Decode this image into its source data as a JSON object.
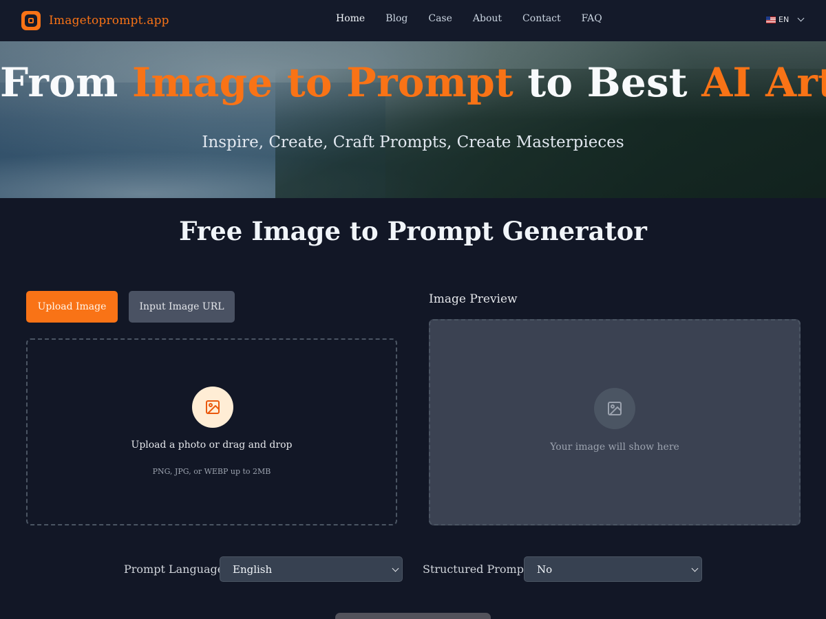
{
  "nav": {
    "brand": "Imagetoprompt.app",
    "links": [
      "Home",
      "Blog",
      "Case",
      "About",
      "Contact",
      "FAQ"
    ],
    "language": "EN"
  },
  "hero": {
    "title_part1": "From ",
    "title_accent1": "Image to Prompt",
    "title_part2": " to Best ",
    "title_accent2": "AI Art",
    "subtitle": "Inspire, Create, Craft Prompts, Create Masterpieces"
  },
  "main": {
    "title": "Free Image to Prompt Generator",
    "tabs": [
      "Upload Image",
      "Input Image URL"
    ],
    "upload": {
      "text": "Upload a photo or drag and drop",
      "hint": "PNG, JPG, or WEBP up to 2MB"
    },
    "preview": {
      "label": "Image Preview",
      "placeholder": "Your image will show here"
    },
    "options": {
      "language_label": "Prompt Language",
      "language_value": "English",
      "structured_label": "Structured Prompt",
      "structured_value": "No"
    }
  },
  "colors": {
    "accent": "#f97316",
    "background": "#121726",
    "panel": "#3b4252"
  },
  "icons": {
    "logo": "camera-square-icon",
    "upload": "image-icon",
    "preview": "image-icon",
    "lang": "flag-us-icon",
    "dropdown": "chevron-down-icon"
  }
}
